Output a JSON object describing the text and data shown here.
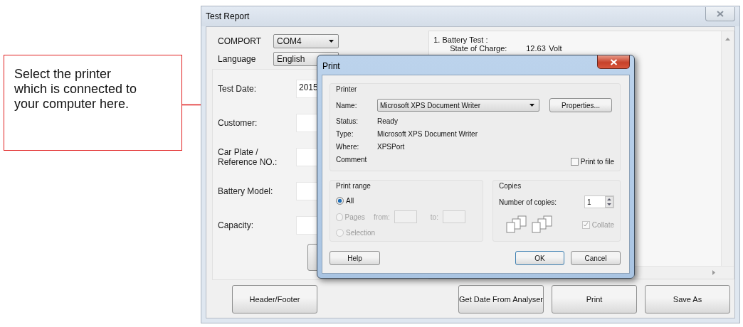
{
  "callout": {
    "text": "Select the printer which is connected to your computer here."
  },
  "main_window": {
    "title": "Test Report",
    "settings": [
      {
        "label": "COMPORT",
        "value": "COM4"
      },
      {
        "label": "Language",
        "value": "English"
      }
    ],
    "fields": [
      {
        "label": "Test Date:",
        "value": "2015"
      },
      {
        "label": "Customer:"
      },
      {
        "label": "Car Plate /\nReference NO.:"
      },
      {
        "label": "Battery Model:"
      },
      {
        "label": "Capacity:"
      }
    ],
    "report": {
      "heading": "1.  Battery Test :",
      "lines": [
        {
          "label": "State of Charge:",
          "value": "12.63",
          "unit": "Volt"
        }
      ]
    },
    "left_buttons": [
      "Header/Footer"
    ],
    "right_buttons": [
      "Get Date From Analyser",
      "Print",
      "Save As"
    ]
  },
  "print_dialog": {
    "title": "Print",
    "printer": {
      "group": "Printer",
      "name_label": "Name:",
      "name_value": "Microsoft XPS Document Writer",
      "properties": "Properties...",
      "info": [
        {
          "label": "Status:",
          "value": "Ready"
        },
        {
          "label": "Type:",
          "value": "Microsoft XPS Document Writer"
        },
        {
          "label": "Where:",
          "value": "XPSPort"
        },
        {
          "label": "Comment"
        }
      ],
      "print_to_file": {
        "label": "Print to file",
        "checked": false
      }
    },
    "range": {
      "group": "Print range",
      "options": [
        {
          "label": "All",
          "selected": true,
          "disabled": false
        },
        {
          "label": "Pages",
          "selected": false,
          "disabled": true
        },
        {
          "label": "Selection",
          "selected": false,
          "disabled": true
        }
      ],
      "from_label": "from:",
      "to_label": "to:"
    },
    "copies": {
      "group": "Copies",
      "label": "Number of copies:",
      "value": "1",
      "collate": {
        "label": "Collate",
        "checked": true,
        "disabled": true
      }
    },
    "buttons": {
      "help": "Help",
      "ok": "OK",
      "cancel": "Cancel"
    }
  }
}
